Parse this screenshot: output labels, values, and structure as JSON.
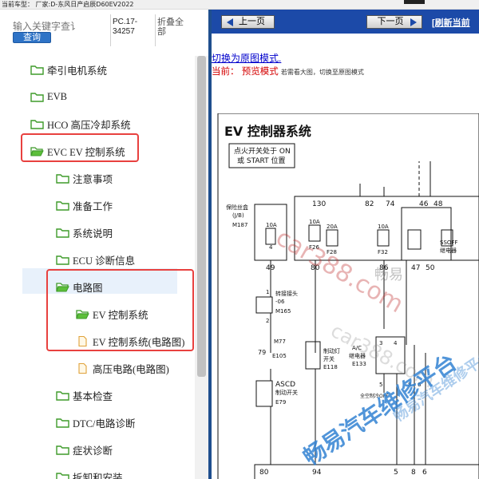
{
  "topbar": {
    "text": "当前车型：  厂家:D-东风日产启辰D60EV2022"
  },
  "search": {
    "placeholder": "输入关键字查讠",
    "button": "查询"
  },
  "version": "PC.17-34257",
  "collapse_all": "折叠全部",
  "tree": [
    {
      "label": "牵引电机系统",
      "icon": "folder-icon"
    },
    {
      "label": "EVB",
      "icon": "folder-icon"
    },
    {
      "label": "HCO 高压冷却系统",
      "icon": "folder-icon"
    },
    {
      "label": "EVC EV 控制系统",
      "icon": "folder-open-icon"
    },
    {
      "label": "注意事项",
      "icon": "folder-icon"
    },
    {
      "label": "准备工作",
      "icon": "folder-icon"
    },
    {
      "label": "系统说明",
      "icon": "folder-icon"
    },
    {
      "label": "ECU 诊断信息",
      "icon": "folder-icon"
    },
    {
      "label": "电路图",
      "icon": "folder-open-icon"
    },
    {
      "label": "EV 控制系统",
      "icon": "folder-open-icon"
    },
    {
      "label": "EV 控制系统(电路图)",
      "icon": "page-icon"
    },
    {
      "label": "高压电路(电路图)",
      "icon": "page-icon"
    },
    {
      "label": "基本检查",
      "icon": "folder-icon"
    },
    {
      "label": "DTC/电路诊断",
      "icon": "folder-icon"
    },
    {
      "label": "症状诊断",
      "icon": "folder-icon"
    },
    {
      "label": "拆卸和安装",
      "icon": "folder-icon"
    }
  ],
  "nav": {
    "prev": "上一页",
    "next": "下一页",
    "refresh": "[刷新当前"
  },
  "switch_link": "切换为原图模式.",
  "current": {
    "label": "当前：",
    "mode": "预览模式",
    "hint": "若需看大图，切换至原图模式"
  },
  "diagram": {
    "title": "EV 控制器系统",
    "ign_box_line1": "点火开关处于 ON",
    "ign_box_line2": "或 START 位置",
    "fuse_box_label1": "保险丝盒",
    "fuse_box_label2": "(J/B)",
    "fuse_box_conn": "M187",
    "fuse1_amp": "10A",
    "fuse1_no": "4",
    "fuse2_amp": "10A",
    "fuse2_no": "F26",
    "fuse3_amp": "20A",
    "fuse3_no": "F28",
    "fuse4_amp": "10A",
    "fuse4_no": "F32",
    "n130": "130",
    "n82": "82",
    "n74": "74",
    "n46": "46",
    "n48": "48",
    "n49": "49",
    "n80": "80",
    "n86": "86",
    "n47": "47",
    "n50": "50",
    "ssoff": "SSOFF",
    "ssoff2": "继电器",
    "joint": "转接接头",
    "joint2": "-06",
    "joint_conn": "M165",
    "p1": "1",
    "p2": "2",
    "m77": "M77",
    "n79": "79",
    "e105": "E105",
    "brake_sw": "制动灯",
    "brake_sw2": "开关",
    "brake_conn": "E118",
    "ac_relay": "A/C",
    "ac_relay2": "继电器",
    "ac_conn": "E133",
    "ascd": "ASCD",
    "ascd2": "制动开关",
    "ascd_conn": "E79",
    "n3": "3",
    "n4": "4",
    "n5": "5",
    "n8": "8",
    "n6": "6",
    "b80": "80",
    "b94": "94",
    "b5": "5",
    "b8": "8",
    "b6": "6",
    "full_ctrl": "全空制冷OFF"
  },
  "watermarks": {
    "w1": "car388.com",
    "w2": "畅易",
    "w3": "car388.com",
    "w4": "畅易汽车维修平台",
    "w5": "畅易汽车维修平台"
  }
}
